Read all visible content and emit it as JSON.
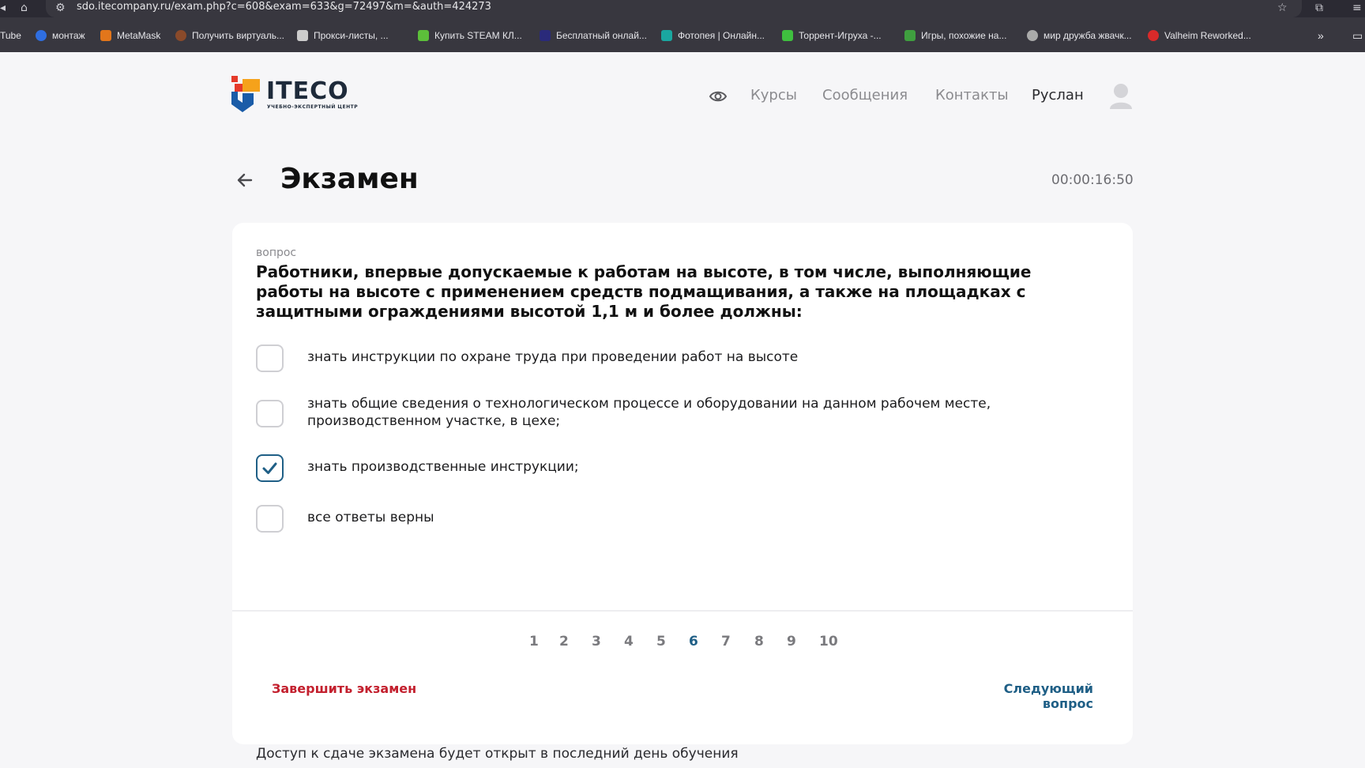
{
  "browser": {
    "url": "sdo.itecompany.ru/exam.php?c=608&exam=633&g=72497&m=&auth=424273",
    "bookmarks": [
      {
        "label": "Tube",
        "color": "#e02020"
      },
      {
        "label": "монтаж",
        "color": "#2f6ee0"
      },
      {
        "label": "MetaMask",
        "color": "#e2761b"
      },
      {
        "label": "Получить виртуаль...",
        "color": "#8a4a2a"
      },
      {
        "label": "Прокси-листы, ...",
        "color": "#cccccc"
      },
      {
        "label": "Купить STEAM КЛ...",
        "color": "#5cbf3a"
      },
      {
        "label": "Бесплатный онлай...",
        "color": "#2a2a7a"
      },
      {
        "label": "Фотопея | Онлайн...",
        "color": "#1aa7a0"
      },
      {
        "label": "Торрент-Игруха -...",
        "color": "#3fbf3f"
      },
      {
        "label": "Игры, похожие на...",
        "color": "#3f9f3f"
      },
      {
        "label": "мир дружба жвачк...",
        "color": "#aaaaaa"
      },
      {
        "label": "Valheim Reworked...",
        "color": "#d82a2a"
      }
    ]
  },
  "header": {
    "brand": "ITECO",
    "brand_sub": "УЧЕБНО-ЭКСПЕРТНЫЙ ЦЕНТР",
    "nav": [
      "Курсы",
      "Сообщения",
      "Контакты"
    ],
    "user": "Руслан"
  },
  "exam": {
    "title": "Экзамен",
    "timer": "00:00:16:50",
    "question_label": "вопрос",
    "question": "Работники, впервые допускаемые к работам на высоте, в том числе, выполняющие работы на высоте с применением средств подмащивания, а также на площадках с защитными ограждениями высотой 1,1 м и более должны:",
    "options": [
      {
        "text": "знать инструкции по охране труда при проведении работ на высоте",
        "checked": false
      },
      {
        "text": "знать общие сведения о технологическом процессе и оборудовании на данном рабочем месте, производственном участке, в цехе;",
        "checked": false
      },
      {
        "text": "знать производственные инструкции;",
        "checked": true
      },
      {
        "text": "все ответы верны",
        "checked": false
      }
    ],
    "pages": [
      "1",
      "2",
      "3",
      "4",
      "5",
      "6",
      "7",
      "8",
      "9",
      "10"
    ],
    "current_page": "6",
    "finish_label": "Завершить экзамен",
    "next_label": "Следующий вопрос",
    "access_note": "Доступ к сдаче экзамена будет открыт в последний день обучения"
  },
  "colors": {
    "accent": "#1f5f86",
    "danger": "#c3202e",
    "logo_red": "#e53a2a",
    "logo_orange": "#f5a21b",
    "logo_blue": "#1a5ca8"
  }
}
